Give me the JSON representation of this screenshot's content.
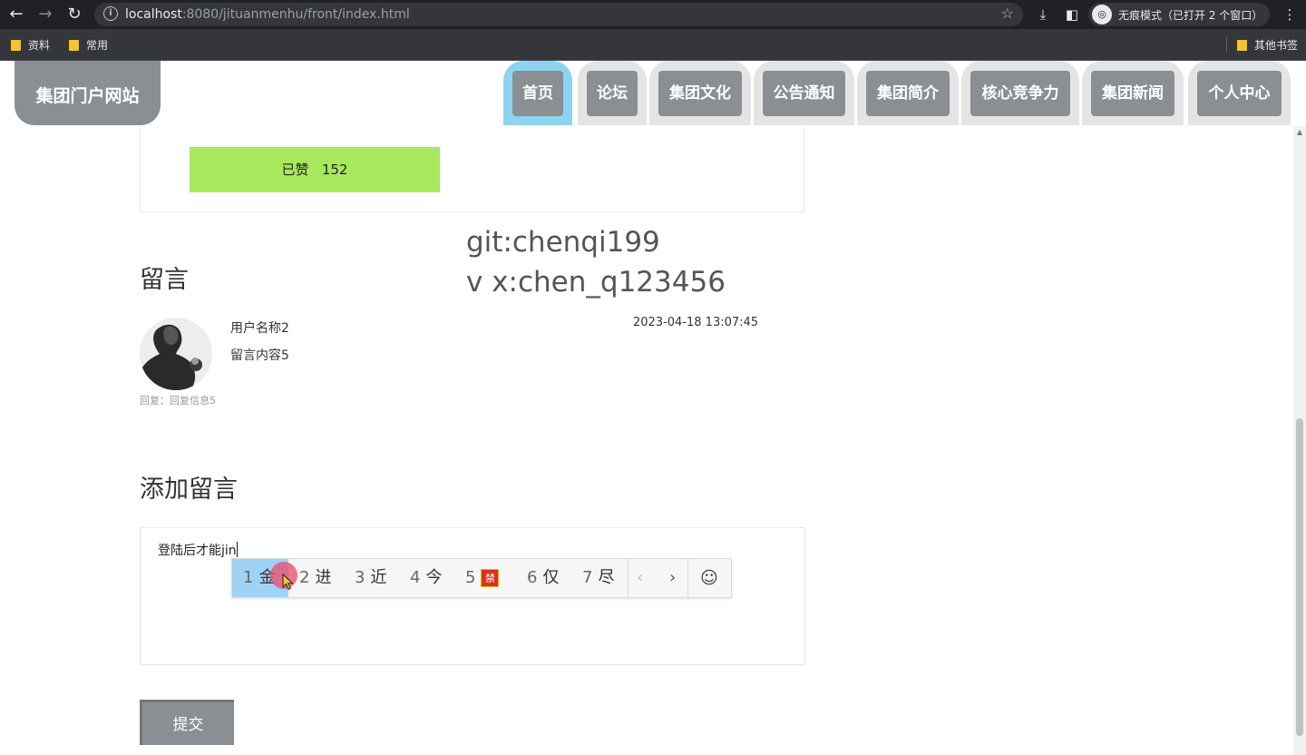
{
  "browser": {
    "back_icon": "arrow-left-icon",
    "forward_icon": "arrow-right-icon",
    "reload_icon": "reload-icon",
    "url_host": "localhost",
    "url_rest": ":8080/jituanmenhu/front/index.html",
    "incognito_label": "无痕模式（已打开 2 个窗口）",
    "bookmarks": [
      "资料",
      "常用"
    ],
    "other_bookmarks": "其他书签"
  },
  "site": {
    "logo": "集团门户网站",
    "nav": [
      "首页",
      "论坛",
      "集团文化",
      "公告通知",
      "集团简介",
      "核心竞争力",
      "集团新闻",
      "个人中心"
    ],
    "active_tab": "首页"
  },
  "like": {
    "label": "已赞",
    "count": "152"
  },
  "overlay": {
    "line1": "git:chenqi199",
    "line2": "v x:chen_q123456"
  },
  "messages_title": "留言",
  "message": {
    "user": "用户名称2",
    "content": "留言内容5",
    "time": "2023-04-18 13:07:45",
    "reply": "回复：回复信息5"
  },
  "add_title": "添加留言",
  "textarea_value": "登陆后才能jin",
  "ime": {
    "candidates": [
      {
        "num": "1",
        "char": "金"
      },
      {
        "num": "2",
        "char": "进"
      },
      {
        "num": "3",
        "char": "近"
      },
      {
        "num": "4",
        "char": "今"
      },
      {
        "num": "5",
        "char": "禁"
      },
      {
        "num": "6",
        "char": "仅"
      },
      {
        "num": "7",
        "char": "尽"
      }
    ],
    "prev": "‹",
    "next": "›",
    "emoji": "☺"
  },
  "submit_label": "提交"
}
